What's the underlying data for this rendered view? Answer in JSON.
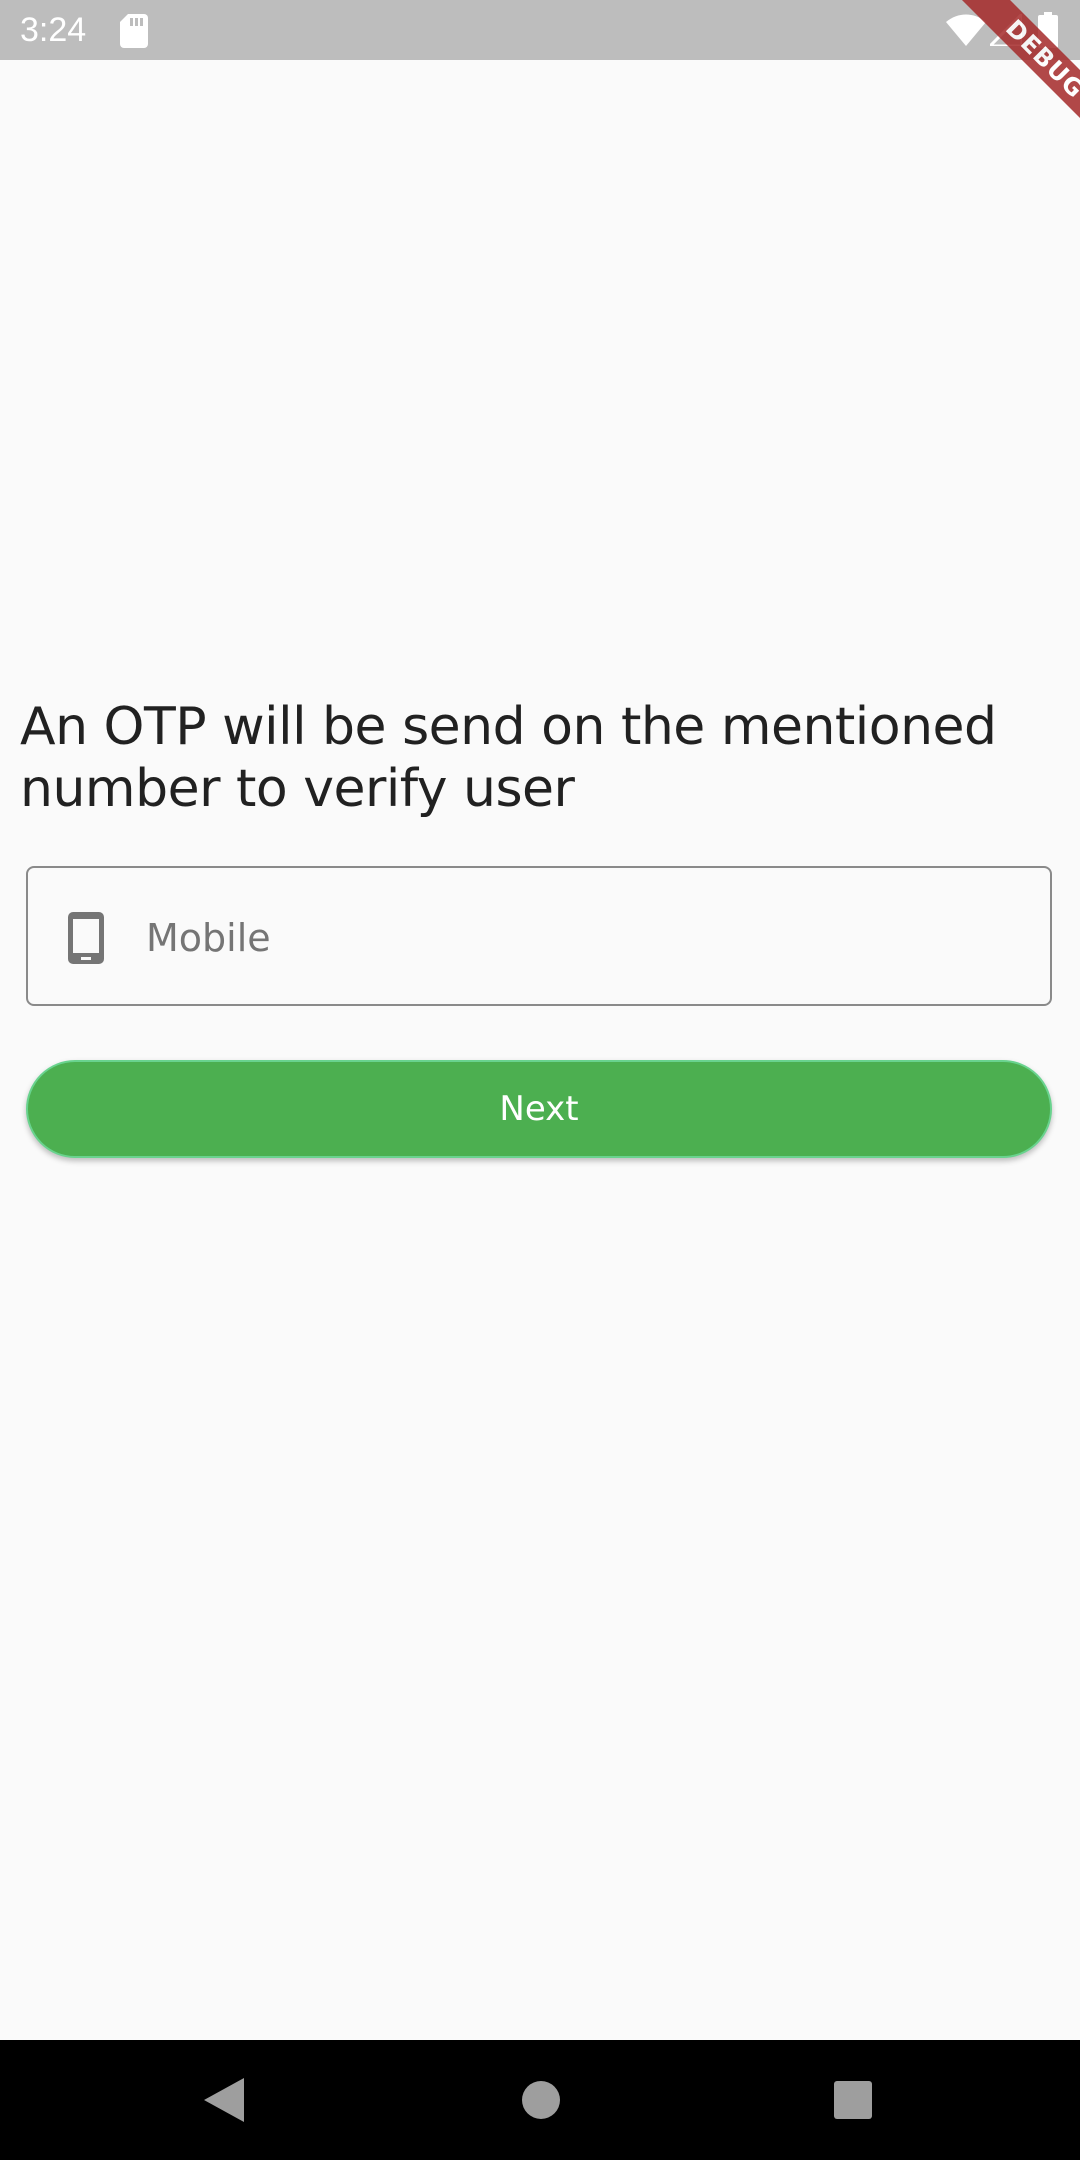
{
  "status_bar": {
    "time": "3:24",
    "icons": [
      "sd-card-icon",
      "wifi-icon",
      "signal-icon",
      "battery-icon"
    ]
  },
  "debug_banner": {
    "label": "DEBUG"
  },
  "otp_screen": {
    "heading": "An OTP will be send on the mentioned number to verify user",
    "mobile_field": {
      "placeholder": "Mobile",
      "value": "",
      "icon": "phone-icon"
    },
    "next_button": {
      "label": "Next"
    }
  },
  "nav_bar": {
    "buttons": [
      "back",
      "home",
      "recents"
    ]
  },
  "colors": {
    "accent": "#4caf50",
    "status_bar": "#bdbdbd",
    "background": "#fafafa",
    "debug_ribbon": "#a52a2a"
  }
}
